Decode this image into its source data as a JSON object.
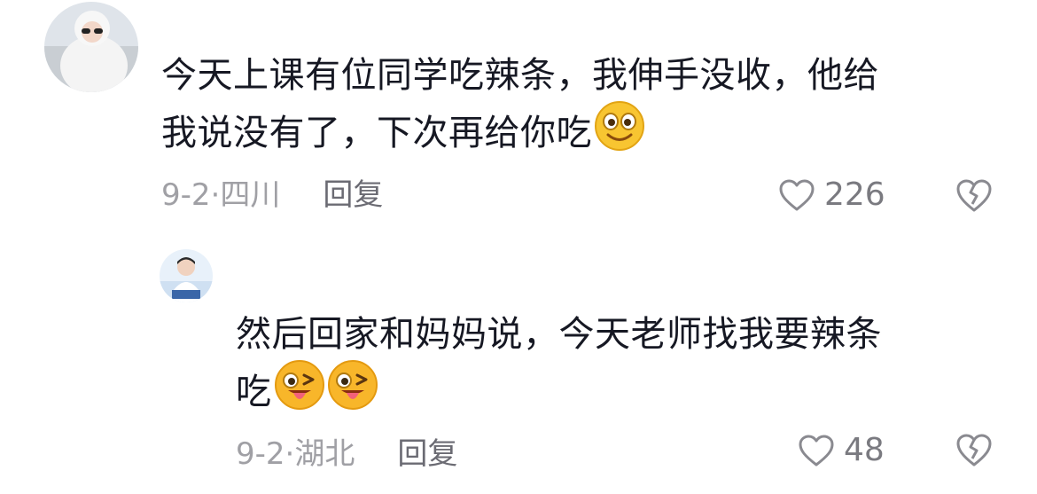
{
  "comments": [
    {
      "text_line1": "今天上课有位同学吃辣条，我伸手没收，他给",
      "text_line2": "我说没有了，下次再给你吃",
      "emoji": "smiling-face-emoji",
      "date": "9-2·",
      "location": "四川",
      "reply_label": "回复",
      "likes": "226"
    },
    {
      "text_line1": "然后回家和妈妈说，今天老师找我要辣条",
      "text_line2": "吃",
      "emoji": "tongue-wink-emoji",
      "date": "9-2·",
      "location": "湖北",
      "reply_label": "回复",
      "likes": "48"
    }
  ],
  "colors": {
    "text": "#161823",
    "meta": "#a0a0a5",
    "icon": "#8a8a90"
  }
}
